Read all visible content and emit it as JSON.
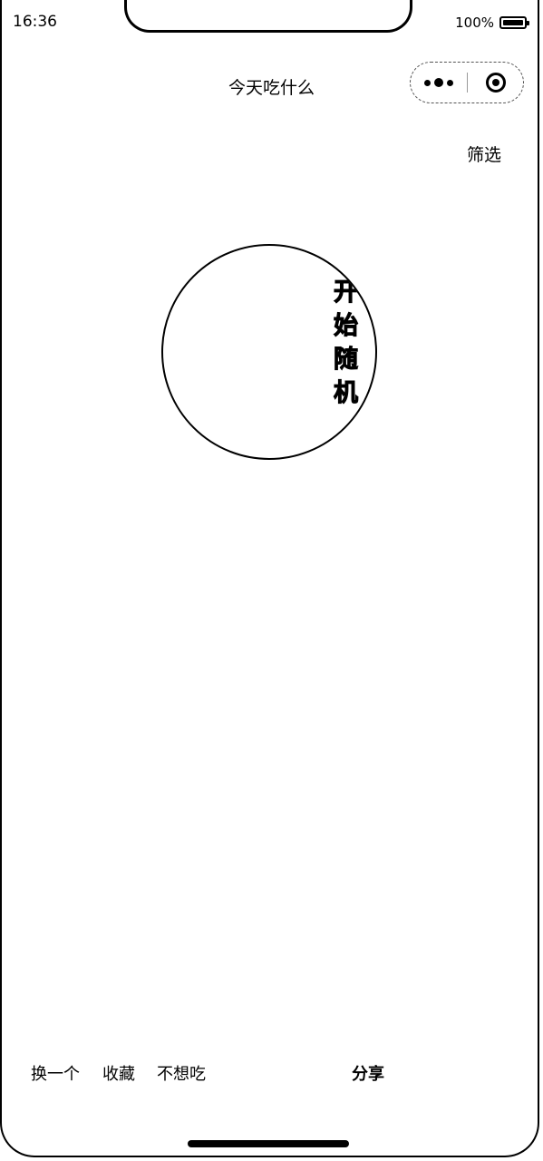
{
  "status_bar": {
    "time": "16:36",
    "battery_percent": "100%",
    "battery_level": 1.0
  },
  "nav": {
    "title": "今天吃什么",
    "more_icon": "more-dots-icon",
    "close_icon": "target-close-icon"
  },
  "filter": {
    "label": "筛选"
  },
  "random_button": {
    "label": "开始随机"
  },
  "bottom_actions": {
    "change": "换一个",
    "favorite": "收藏",
    "dislike": "不想吃",
    "share": "分享"
  },
  "colors": {
    "text": "#000000",
    "background": "#ffffff"
  }
}
